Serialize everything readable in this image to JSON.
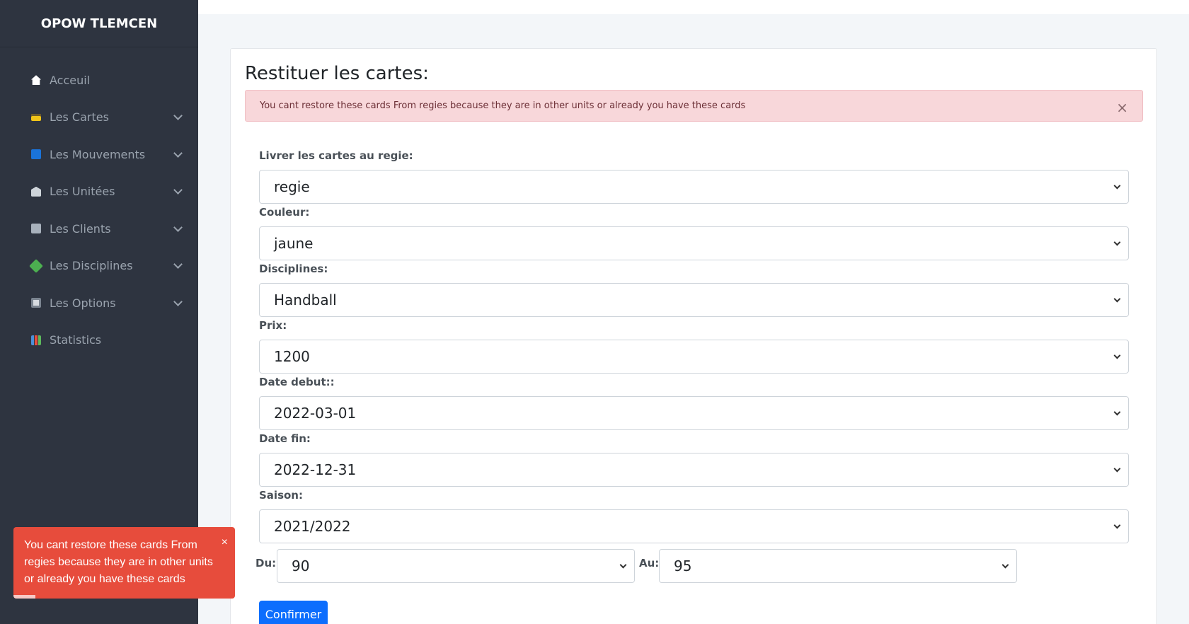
{
  "sidebar": {
    "brand": "OPOW TLEMCEN",
    "items": [
      {
        "label": "Acceuil",
        "icon": "home-icon"
      },
      {
        "label": "Les Cartes",
        "icon": "card-icon"
      },
      {
        "label": "Les Mouvements",
        "icon": "swap-icon"
      },
      {
        "label": "Les Unitées",
        "icon": "building-icon"
      },
      {
        "label": "Les Clients",
        "icon": "users-icon"
      },
      {
        "label": "Les Disciplines",
        "icon": "puzzle-icon"
      },
      {
        "label": "Les Options",
        "icon": "gear-icon"
      },
      {
        "label": "Statistics",
        "icon": "chart-icon"
      }
    ]
  },
  "main": {
    "title": "Restituer les cartes:",
    "alert": "You cant restore these cards From regies because they are in other units or already you have these cards",
    "alert_close": "×",
    "fields": {
      "regie_label": "Livrer les cartes au regie:",
      "regie_value": "regie",
      "couleur_label": "Couleur:",
      "couleur_value": "jaune",
      "disciplines_label": "Disciplines:",
      "disciplines_value": "Handball",
      "prix_label": "Prix:",
      "prix_value": "1200",
      "date_debut_label": "Date debut::",
      "date_debut_value": "2022-03-01",
      "date_fin_label": "Date fin:",
      "date_fin_value": "2022-12-31",
      "saison_label": "Saison:",
      "saison_value": "2021/2022",
      "du_label": "Du:",
      "du_value": "90",
      "au_label": "Au:",
      "au_value": "95"
    },
    "confirm_label": "Confirmer"
  },
  "toast": {
    "message": "You cant restore these cards From regies because they are in other units or already you have these cards",
    "close": "×",
    "progress": 0.1
  },
  "colors": {
    "sidebar_bg": "#2e3440",
    "primary": "#0d6efd",
    "toast_bg": "#e74c3c",
    "alert_bg": "#f8d7da"
  }
}
